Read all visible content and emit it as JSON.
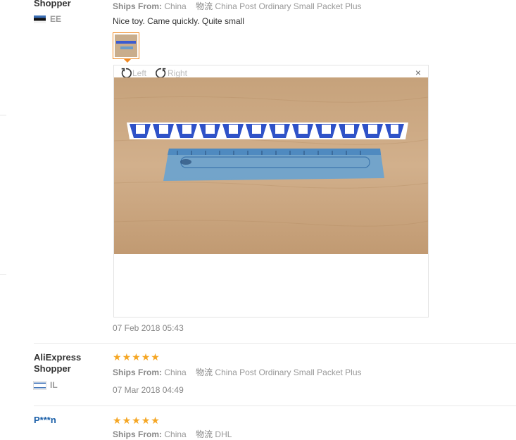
{
  "reviews": [
    {
      "name": "Shopper",
      "country": "EE",
      "ships_from_label": "Ships From:",
      "ships_from": "China",
      "logistics_label": "物流",
      "logistics": "China Post Ordinary Small Packet Plus",
      "text": "Nice toy. Came quickly. Quite small",
      "date": "07 Feb 2018 05:43",
      "viewer": {
        "rotate_left": "Left",
        "rotate_right": "Right",
        "close": "×"
      }
    },
    {
      "name": "AliExpress Shopper",
      "country": "IL",
      "rating": 5,
      "ships_from_label": "Ships From:",
      "ships_from": "China",
      "logistics_label": "物流",
      "logistics": "China Post Ordinary Small Packet Plus",
      "date": "07 Mar 2018 04:49"
    },
    {
      "name": "P***n",
      "rating": 5,
      "ships_from_label": "Ships From:",
      "ships_from": "China",
      "logistics_label": "物流",
      "logistics": "DHL"
    }
  ],
  "colors": {
    "star": "#f5a623",
    "accent": "#f08a24",
    "link": "#1a5fa8"
  },
  "icons": {
    "star": "★",
    "rotate_left": "rotate-left-icon",
    "rotate_right": "rotate-right-icon",
    "close": "close-icon"
  }
}
